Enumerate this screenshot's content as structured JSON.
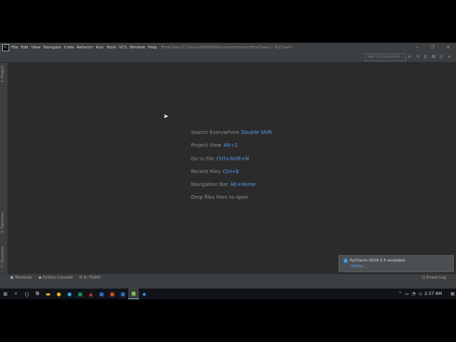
{
  "window": {
    "menu": [
      "File",
      "Edit",
      "View",
      "Navigate",
      "Code",
      "Refactor",
      "Run",
      "Tools",
      "VCS",
      "Window",
      "Help"
    ],
    "title": "FirstClass [C:\\Users\\MISBAH\\PycharmProjects\\FirstClass] - PyCharm",
    "controls": [
      "–",
      "❐",
      "✕"
    ]
  },
  "toolbar": {
    "add_config": "Add Configuration...",
    "icons": [
      "run-icon",
      "debug-icon",
      "coverage-icon",
      "stop-icon",
      "structure-icon",
      "search-icon"
    ]
  },
  "left_tabs": {
    "project": "1: Project",
    "favorites": "2: Favorites",
    "structure": "7: Structure"
  },
  "hints": [
    {
      "label": "Search Everywhere",
      "key": "Double Shift"
    },
    {
      "label": "Project View",
      "key": "Alt+1"
    },
    {
      "label": "Go to File",
      "key": "Ctrl+Shift+N"
    },
    {
      "label": "Recent Files",
      "key": "Ctrl+E"
    },
    {
      "label": "Navigation Bar",
      "key": "Alt+Home"
    },
    {
      "label": "Drop files here to open",
      "key": ""
    }
  ],
  "bottom_tabs": {
    "terminal": "Terminal",
    "python_console": "Python Console",
    "todo": "6: TODO",
    "event_log": "Event Log"
  },
  "notification": {
    "title": "PyCharm 2019.3.5 available",
    "link": "Update..."
  },
  "taskbar": {
    "time": "2:37 AM"
  },
  "colors": {
    "editor_bg": "#2b2b2b",
    "panel_bg": "#3c3f41",
    "accent": "#589df6"
  }
}
